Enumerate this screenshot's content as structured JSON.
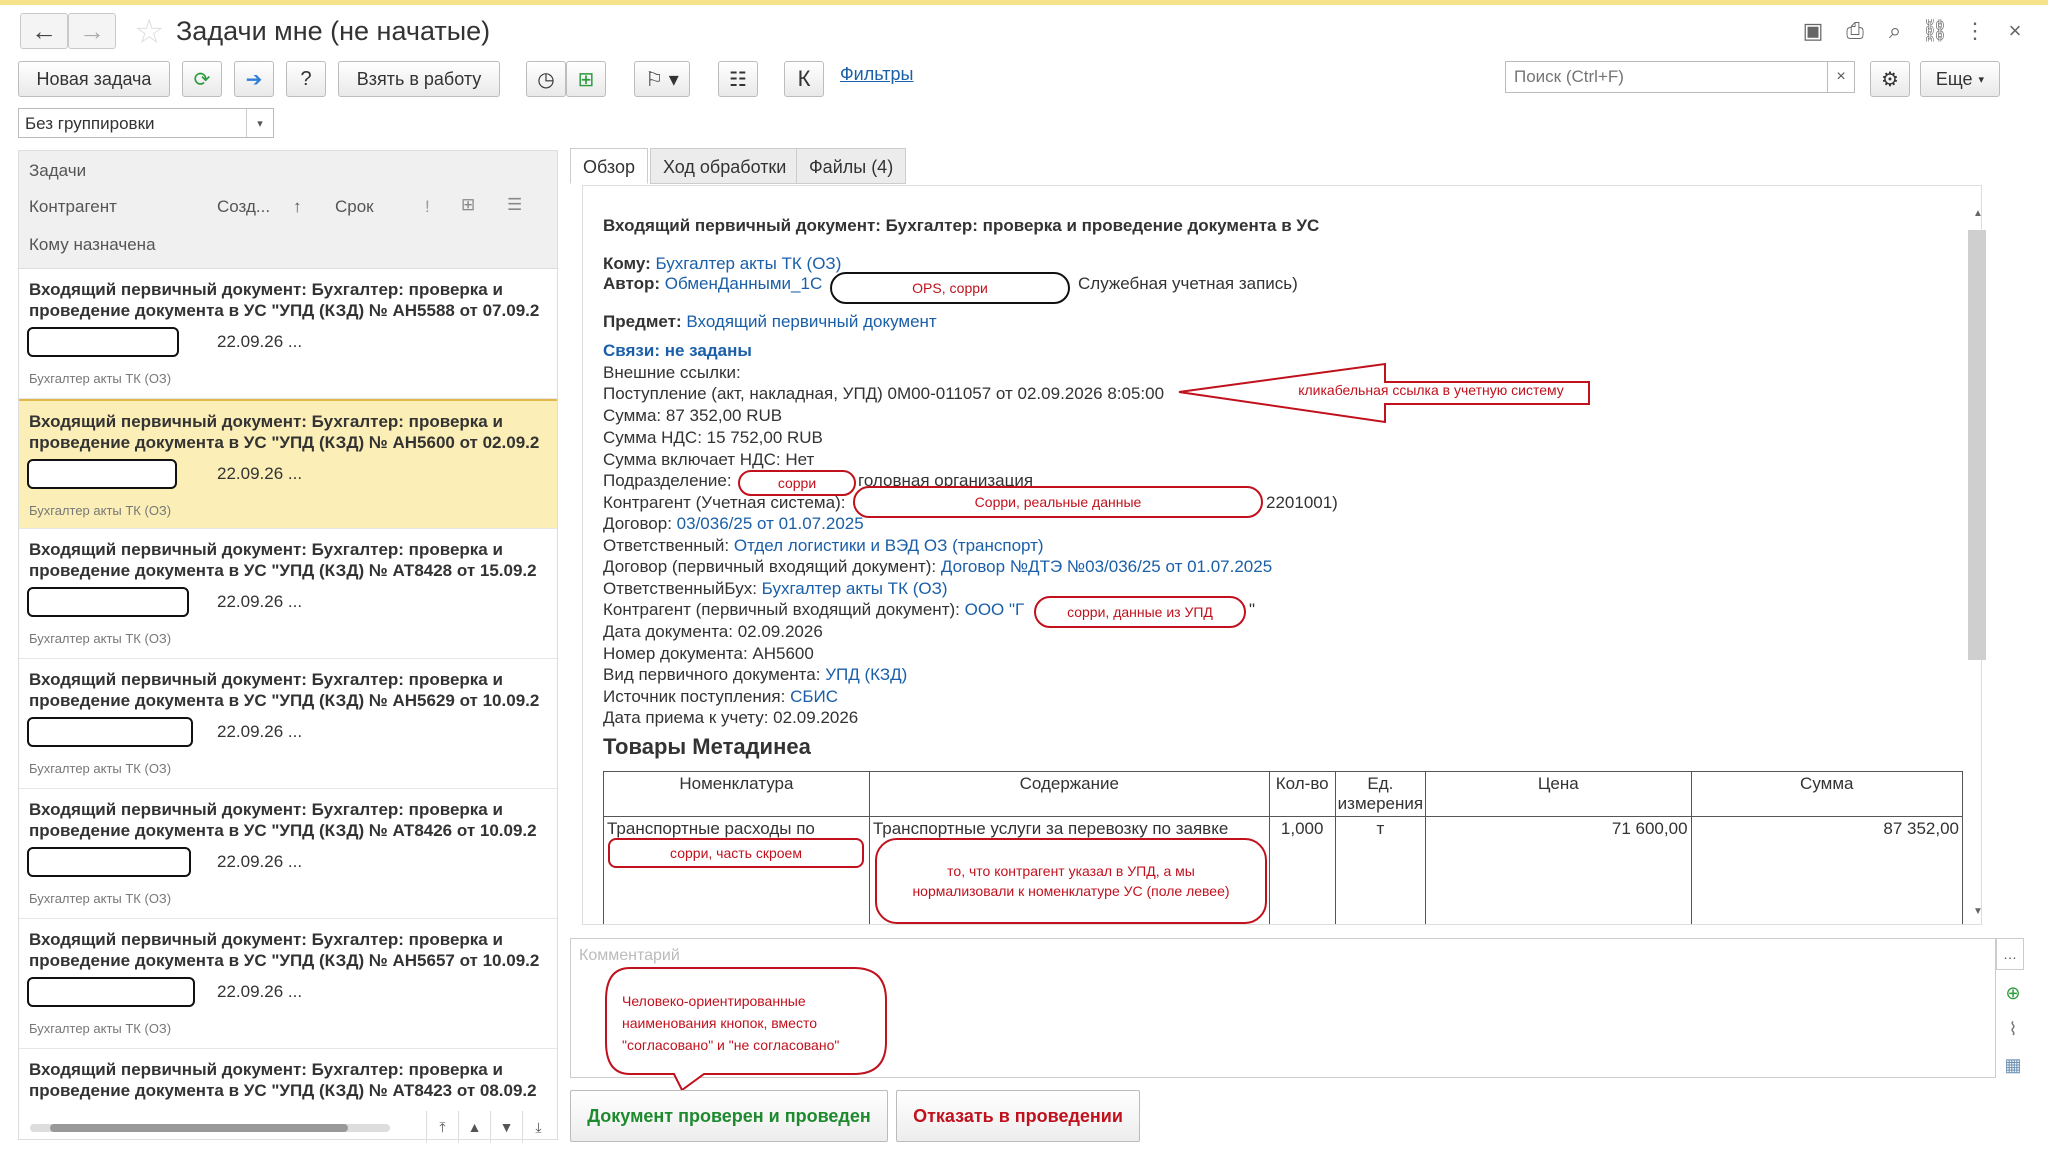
{
  "window": {
    "title": "Задачи мне (не начатые)"
  },
  "toolbar": {
    "new_task": "Новая задача",
    "take": "Взять в работу",
    "k_label": "К",
    "filters": "Фильтры",
    "search_placeholder": "Поиск (Ctrl+F)",
    "more": "Еще"
  },
  "grouping": {
    "value": "Без группировки"
  },
  "list": {
    "headers": {
      "tasks": "Задачи",
      "counterparty": "Контрагент",
      "created": "Созд...",
      "sort": "↑",
      "due": "Срок",
      "assigned": "Кому назначена"
    },
    "items": [
      {
        "line1": "Входящий первичный документ: Бухгалтер: проверка и",
        "line2": "проведение документа в УС \"УПД (КЗД) № АН5588 от 07.09.2",
        "date": "22.09.26 ...",
        "assignee": "Бухгалтер акты ТК (ОЗ)"
      },
      {
        "line1": "Входящий первичный документ: Бухгалтер: проверка и",
        "line2": "проведение документа в УС \"УПД (КЗД) № АН5600 от 02.09.2",
        "date": "22.09.26 ...",
        "assignee": "Бухгалтер акты ТК (ОЗ)"
      },
      {
        "line1": "Входящий первичный документ: Бухгалтер: проверка и",
        "line2": "проведение документа в УС \"УПД (КЗД) № АТ8428 от 15.09.2",
        "date": "22.09.26 ...",
        "assignee": "Бухгалтер акты ТК (ОЗ)"
      },
      {
        "line1": "Входящий первичный документ: Бухгалтер: проверка и",
        "line2": "проведение документа в УС \"УПД (КЗД) № АН5629 от 10.09.2",
        "date": "22.09.26 ...",
        "assignee": "Бухгалтер акты ТК (ОЗ)"
      },
      {
        "line1": "Входящий первичный документ: Бухгалтер: проверка и",
        "line2": "проведение документа в УС \"УПД (КЗД) № АТ8426 от 10.09.2",
        "date": "22.09.26 ...",
        "assignee": "Бухгалтер акты ТК (ОЗ)"
      },
      {
        "line1": "Входящий первичный документ: Бухгалтер: проверка и",
        "line2": "проведение документа в УС \"УПД (КЗД) № АН5657 от 10.09.2",
        "date": "22.09.26 ...",
        "assignee": "Бухгалтер акты ТК (ОЗ)"
      },
      {
        "line1": "Входящий первичный документ: Бухгалтер: проверка и",
        "line2": "проведение документа в УС \"УПД (КЗД) № АТ8423 от 08.09.2",
        "date": "",
        "assignee": ""
      }
    ]
  },
  "tabs": [
    "Обзор",
    "Ход обработки",
    "Файлы (4)"
  ],
  "detail": {
    "title": "Входящий первичный документ: Бухгалтер: проверка и проведение документа в УС",
    "to_label": "Кому:",
    "to_value": "Бухгалтер акты ТК (ОЗ)",
    "author_label": "Автор:",
    "author_value": "ОбменДанными_1С",
    "author_suffix": "Служебная учетная запись)",
    "subject_label": "Предмет:",
    "subject_value": "Входящий первичный документ",
    "links_label": "Связи: не заданы",
    "external_label": "Внешние ссылки:",
    "receipt_link": "Поступление (акт, накладная, УПД) 0М00-011057 от 02.09.2026 8:05:00",
    "sum": "Сумма: 87 352,00 RUB",
    "vat": "Сумма НДС: 15 752,00 RUB",
    "vat_incl": "Сумма включает НДС: Нет",
    "division_label": "Подразделение:",
    "division_value": "головная организация",
    "cp_label": "Контрагент (Учетная система):",
    "cp_suffix": "2201001)",
    "contract_label": "Договор:",
    "contract_value": "03/036/25 от 01.07.2025",
    "resp_label": "Ответственный:",
    "resp_value": "Отдел логистики и ВЭД ОЗ (транспорт)",
    "contract2_label": "Договор (первичный входящий документ):",
    "contract2_value": "Договор №ДТЭ №03/036/25 от 01.07.2025",
    "respacc_label": "ОтветственныйБух:",
    "respacc_value": "Бухгалтер акты ТК (ОЗ)",
    "cp2_label": "Контрагент (первичный входящий документ):",
    "cp2_value": "ООО \"Г",
    "cp2_suffix": "\"",
    "doc_date": "Дата документа: 02.09.2026",
    "doc_number": "Номер документа: АН5600",
    "doc_type_label": "Вид первичного документа:",
    "doc_type_value": "УПД (КЗД)",
    "source_label": "Источник поступления:",
    "source_value": "СБИС",
    "accept_date": "Дата приема к учету: 02.09.2026",
    "goods_title": "Товары Метадинеа",
    "table": {
      "headers": [
        "Номенклатура",
        "Содержание",
        "Кол-во",
        "Ед. измерения",
        "Цена",
        "Сумма"
      ],
      "row": {
        "nomenclature": "Транспортные расходы по",
        "content": "Транспортные услуги за перевозку по заявке",
        "qty": "1,000",
        "unit": "т",
        "price": "71 600,00",
        "sum": "87 352,00"
      }
    }
  },
  "annotations": {
    "ops": "OPS, сорри",
    "link_note": "кликабельная ссылка в учетную систему",
    "sorry": "сорри",
    "real_data": "Сорри, реальные данные",
    "upd_data": "сорри, данные из УПД",
    "screen_part": "сорри, часть скроем",
    "normalized": "то, что контрагент указал в УПД, а мы нормализовали к номенклатуре УС (поле левее)",
    "buttons_note": "Человеко-ориентированные наименования кнопок, вместо \"согласовано\" и \"не согласовано\""
  },
  "comment": {
    "placeholder": "Комментарий"
  },
  "actions": {
    "approve": "Документ проверен и проведен",
    "reject": "Отказать в проведении"
  },
  "colors": {
    "link": "#1a5fa8",
    "annotation": "#c0111d",
    "approve": "#1e8a2e",
    "reject": "#c0111d",
    "selected_row": "#fbefb7"
  }
}
